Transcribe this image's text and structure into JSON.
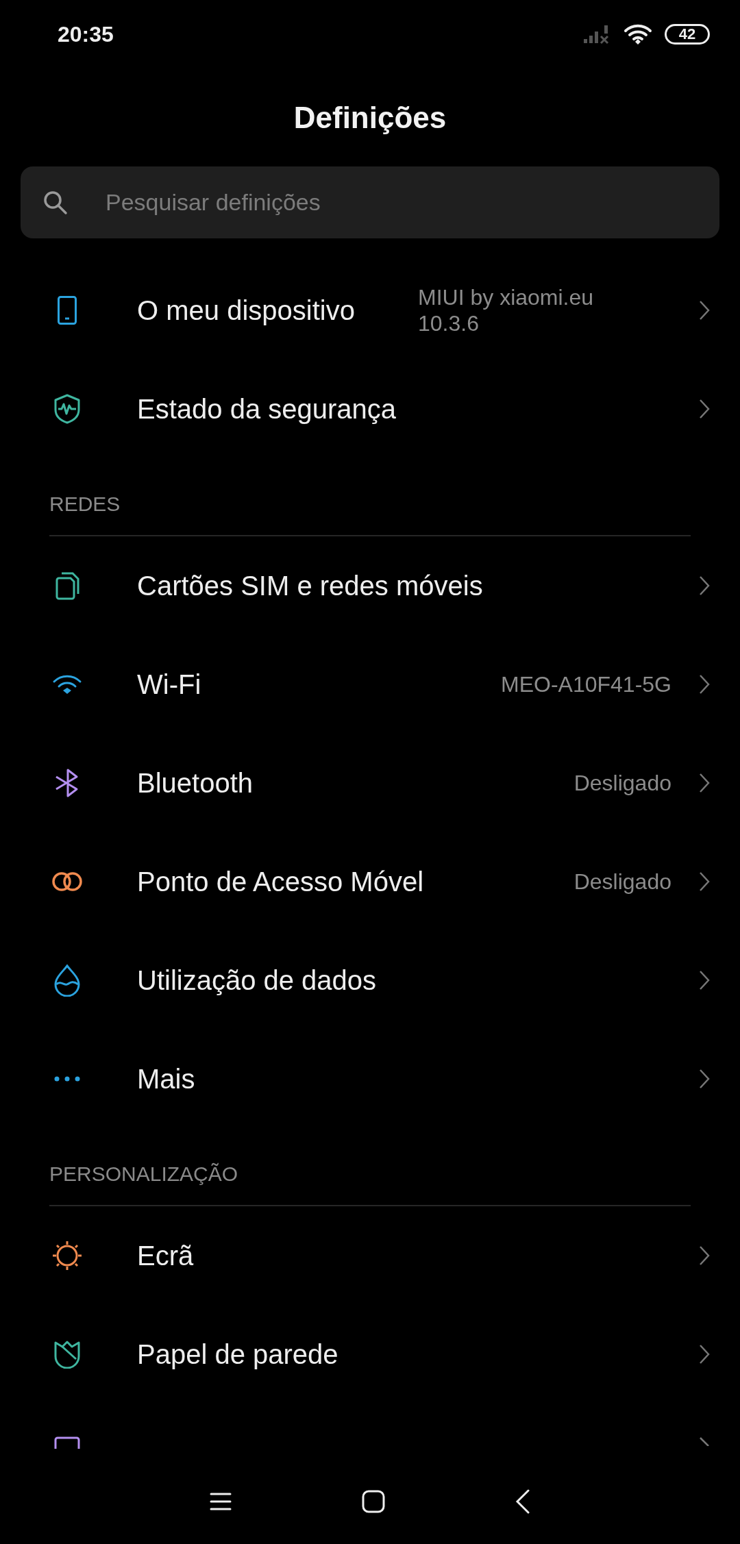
{
  "status_bar": {
    "time": "20:35",
    "battery": "42"
  },
  "title": "Definições",
  "search": {
    "placeholder": "Pesquisar definições"
  },
  "sections": [
    {
      "items": [
        {
          "label": "O meu dispositivo",
          "value": "MIUI by xiaomi.eu 10.3.6"
        },
        {
          "label": "Estado da segurança"
        }
      ]
    },
    {
      "header": "REDES",
      "items": [
        {
          "label": "Cartões SIM e redes móveis"
        },
        {
          "label": "Wi-Fi",
          "value": "MEO-A10F41-5G"
        },
        {
          "label": "Bluetooth",
          "value": "Desligado"
        },
        {
          "label": "Ponto de Acesso Móvel",
          "value": "Desligado"
        },
        {
          "label": "Utilização de dados"
        },
        {
          "label": "Mais"
        }
      ]
    },
    {
      "header": "PERSONALIZAÇÃO",
      "items": [
        {
          "label": "Ecrã"
        },
        {
          "label": "Papel de parede"
        }
      ]
    }
  ]
}
